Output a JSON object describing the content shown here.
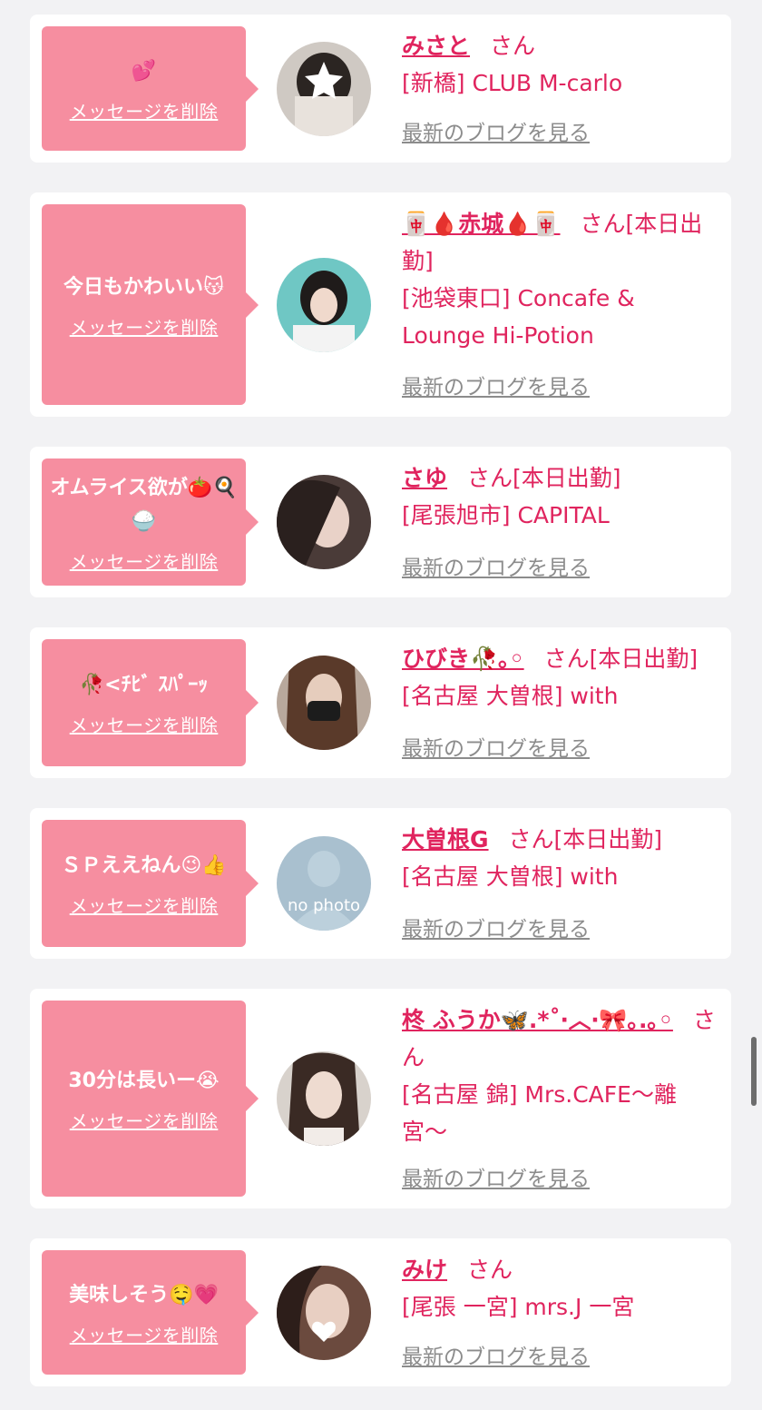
{
  "common": {
    "delete_label": "メッセージを削除",
    "blog_label": "最新のブログを見る",
    "san": "さん"
  },
  "cards": [
    {
      "message": "💕",
      "name": "みさと",
      "suffix": "さん",
      "shop": "[新橋] CLUB M-carlo"
    },
    {
      "message": "今日もかわいい😽",
      "name": "🀄🩸赤城🩸🀄",
      "suffix": "さん[本日出勤]",
      "shop": "[池袋東口] Concafe & Lounge Hi-Potion"
    },
    {
      "message": "オムライス欲が🍅🍳🍚",
      "name": "さゆ",
      "suffix": "さん[本日出勤]",
      "shop": "[尾張旭市] CAPITAL"
    },
    {
      "message": "🥀<ﾁﾋﾞ ｽﾊﾟｰｯ",
      "name": "ひびき🥀｡◦",
      "suffix": "さん[本日出勤]",
      "shop": "[名古屋 大曽根] with"
    },
    {
      "message": "ＳＰええねん😉👍",
      "name": "大曽根G",
      "suffix": "さん[本日出勤]",
      "shop": "[名古屋 大曽根] with",
      "avatar_text": "no photo"
    },
    {
      "message": "30分は長いー😭",
      "name": "柊 ふうか🦋.*˚‧︿‧🎀｡.｡◦",
      "suffix": "さん",
      "shop": "[名古屋 錦] Mrs.CAFE〜離宮〜"
    },
    {
      "message": "美味しそう🤤💗",
      "name": "みけ",
      "suffix": "さん",
      "shop": "[尾張 一宮] mrs.J 一宮"
    }
  ]
}
